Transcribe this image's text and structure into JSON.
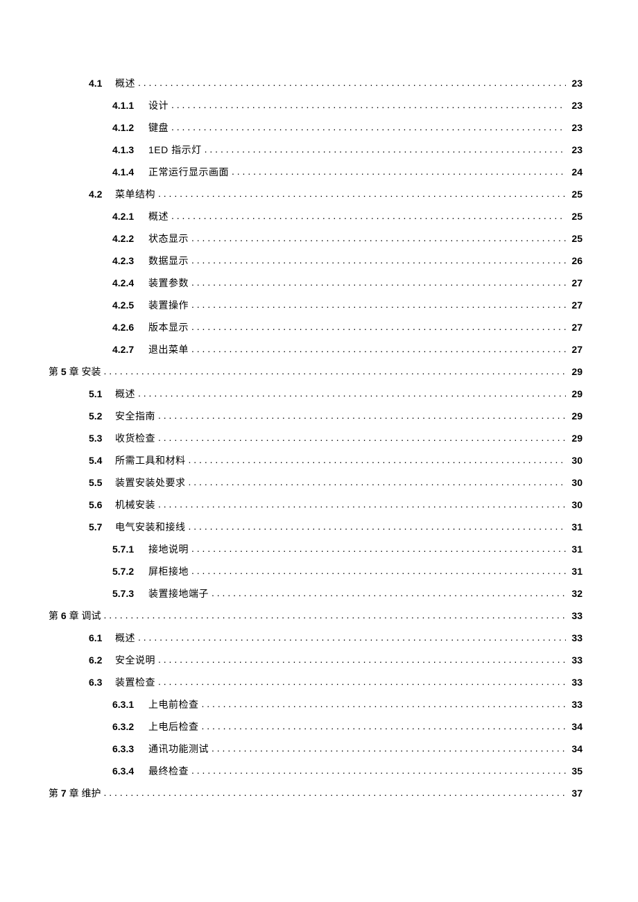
{
  "toc": [
    {
      "indent": 1,
      "num": "4.1",
      "title": "概述",
      "page": "23"
    },
    {
      "indent": 2,
      "num": "4.1.1",
      "title": "设计",
      "page": "23"
    },
    {
      "indent": 2,
      "num": "4.1.2",
      "title": "键盘",
      "page": "23"
    },
    {
      "indent": 2,
      "num": "4.1.3",
      "title": "1ED 指示灯",
      "page": "23"
    },
    {
      "indent": 2,
      "num": "4.1.4",
      "title": "正常运行显示画面",
      "page": "24"
    },
    {
      "indent": 1,
      "num": "4.2",
      "title": "菜单结构",
      "page": "25"
    },
    {
      "indent": 2,
      "num": "4.2.1",
      "title": "概述",
      "page": "25"
    },
    {
      "indent": 2,
      "num": "4.2.2",
      "title": "状态显示",
      "page": "25"
    },
    {
      "indent": 2,
      "num": "4.2.3",
      "title": "数据显示",
      "page": "26"
    },
    {
      "indent": 2,
      "num": "4.2.4",
      "title": "装置参数",
      "page": "27"
    },
    {
      "indent": 2,
      "num": "4.2.5",
      "title": "装置操作",
      "page": "27"
    },
    {
      "indent": 2,
      "num": "4.2.6",
      "title": "版本显示",
      "page": "27"
    },
    {
      "indent": 2,
      "num": "4.2.7",
      "title": "退出菜单",
      "page": "27"
    },
    {
      "indent": 0,
      "chapter": true,
      "prefix": "第",
      "chnum": "5",
      "suffix": "章 安装",
      "page": "29"
    },
    {
      "indent": 1,
      "num": "5.1",
      "title": "概述",
      "page": "29"
    },
    {
      "indent": 1,
      "num": "5.2",
      "title": "安全指南",
      "page": "29"
    },
    {
      "indent": 1,
      "num": "5.3",
      "title": "收货检查",
      "page": "29"
    },
    {
      "indent": 1,
      "num": "5.4",
      "title": "所需工具和材料",
      "page": "30"
    },
    {
      "indent": 1,
      "num": "5.5",
      "title": "装置安装处要求",
      "page": "30"
    },
    {
      "indent": 1,
      "num": "5.6",
      "title": "机械安装",
      "page": "30"
    },
    {
      "indent": 1,
      "num": "5.7",
      "title": "电气安装和接线",
      "page": "31"
    },
    {
      "indent": 2,
      "num": "5.7.1",
      "title": "接地说明",
      "page": "31"
    },
    {
      "indent": 2,
      "num": "5.7.2",
      "title": "屏柜接地",
      "page": "31"
    },
    {
      "indent": 2,
      "num": "5.7.3",
      "title": "装置接地端子",
      "page": "32"
    },
    {
      "indent": 0,
      "chapter": true,
      "prefix": "第",
      "chnum": "6",
      "suffix": "章 调试",
      "page": "33"
    },
    {
      "indent": 1,
      "num": "6.1",
      "title": "概述",
      "page": "33"
    },
    {
      "indent": 1,
      "num": "6.2",
      "title": "安全说明",
      "page": "33"
    },
    {
      "indent": 1,
      "num": "6.3",
      "title": "装置检查",
      "page": "33"
    },
    {
      "indent": 2,
      "num": "6.3.1",
      "title": "上电前检查",
      "page": "33"
    },
    {
      "indent": 2,
      "num": "6.3.2",
      "title": "上电后检查",
      "page": "34"
    },
    {
      "indent": 2,
      "num": "6.3.3",
      "title": "通讯功能测试",
      "page": "34"
    },
    {
      "indent": 2,
      "num": "6.3.4",
      "title": "最终检查",
      "page": "35"
    },
    {
      "indent": 0,
      "chapter": true,
      "prefix": "第",
      "chnum": "7",
      "suffix": "章 维护",
      "page": "37"
    }
  ]
}
